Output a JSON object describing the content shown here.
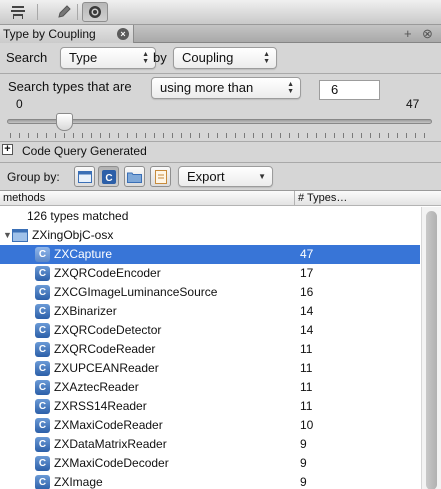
{
  "toolbar": {
    "icons": [
      "table-icon",
      "pencil-icon",
      "search-icon"
    ]
  },
  "panel_tab": {
    "title": "Type by Coupling",
    "close_symbol": "×"
  },
  "window_controls": {
    "pin": "+",
    "close": "⊗"
  },
  "query": {
    "search_label": "Search",
    "search_value": "Type",
    "by_label": "by",
    "by_value": "Coupling",
    "filter_label": "Search types that are",
    "filter_value": "using more than",
    "threshold": "6",
    "range_min": "0",
    "range_max": "47",
    "slider_value": 6,
    "slider_max": 47
  },
  "code_query": {
    "expander": "+",
    "label": "Code Query Generated"
  },
  "group": {
    "label": "Group by:",
    "export_label": "Export"
  },
  "table": {
    "columns": [
      "methods",
      "# Types…"
    ],
    "summary": "126 types matched",
    "group_name": "ZXingObjC-osx",
    "rows": [
      {
        "icon": "C",
        "name": "ZXCapture",
        "count": "47",
        "selected": true
      },
      {
        "icon": "C",
        "name": "ZXQRCodeEncoder",
        "count": "17"
      },
      {
        "icon": "C",
        "name": "ZXCGImageLuminanceSource",
        "count": "16"
      },
      {
        "icon": "C",
        "name": "ZXBinarizer",
        "count": "14"
      },
      {
        "icon": "C",
        "name": "ZXQRCodeDetector",
        "count": "14"
      },
      {
        "icon": "C",
        "name": "ZXQRCodeReader",
        "count": "11"
      },
      {
        "icon": "C",
        "name": "ZXUPCEANReader",
        "count": "11"
      },
      {
        "icon": "C",
        "name": "ZXAztecReader",
        "count": "11"
      },
      {
        "icon": "C",
        "name": "ZXRSS14Reader",
        "count": "11"
      },
      {
        "icon": "C",
        "name": "ZXMaxiCodeReader",
        "count": "10"
      },
      {
        "icon": "C",
        "name": "ZXDataMatrixReader",
        "count": "9"
      },
      {
        "icon": "C",
        "name": "ZXMaxiCodeDecoder",
        "count": "9"
      },
      {
        "icon": "C",
        "name": "ZXImage",
        "count": "9"
      }
    ]
  },
  "colors": {
    "selection": "#3875d7",
    "class_icon": "#2c5fa8"
  }
}
